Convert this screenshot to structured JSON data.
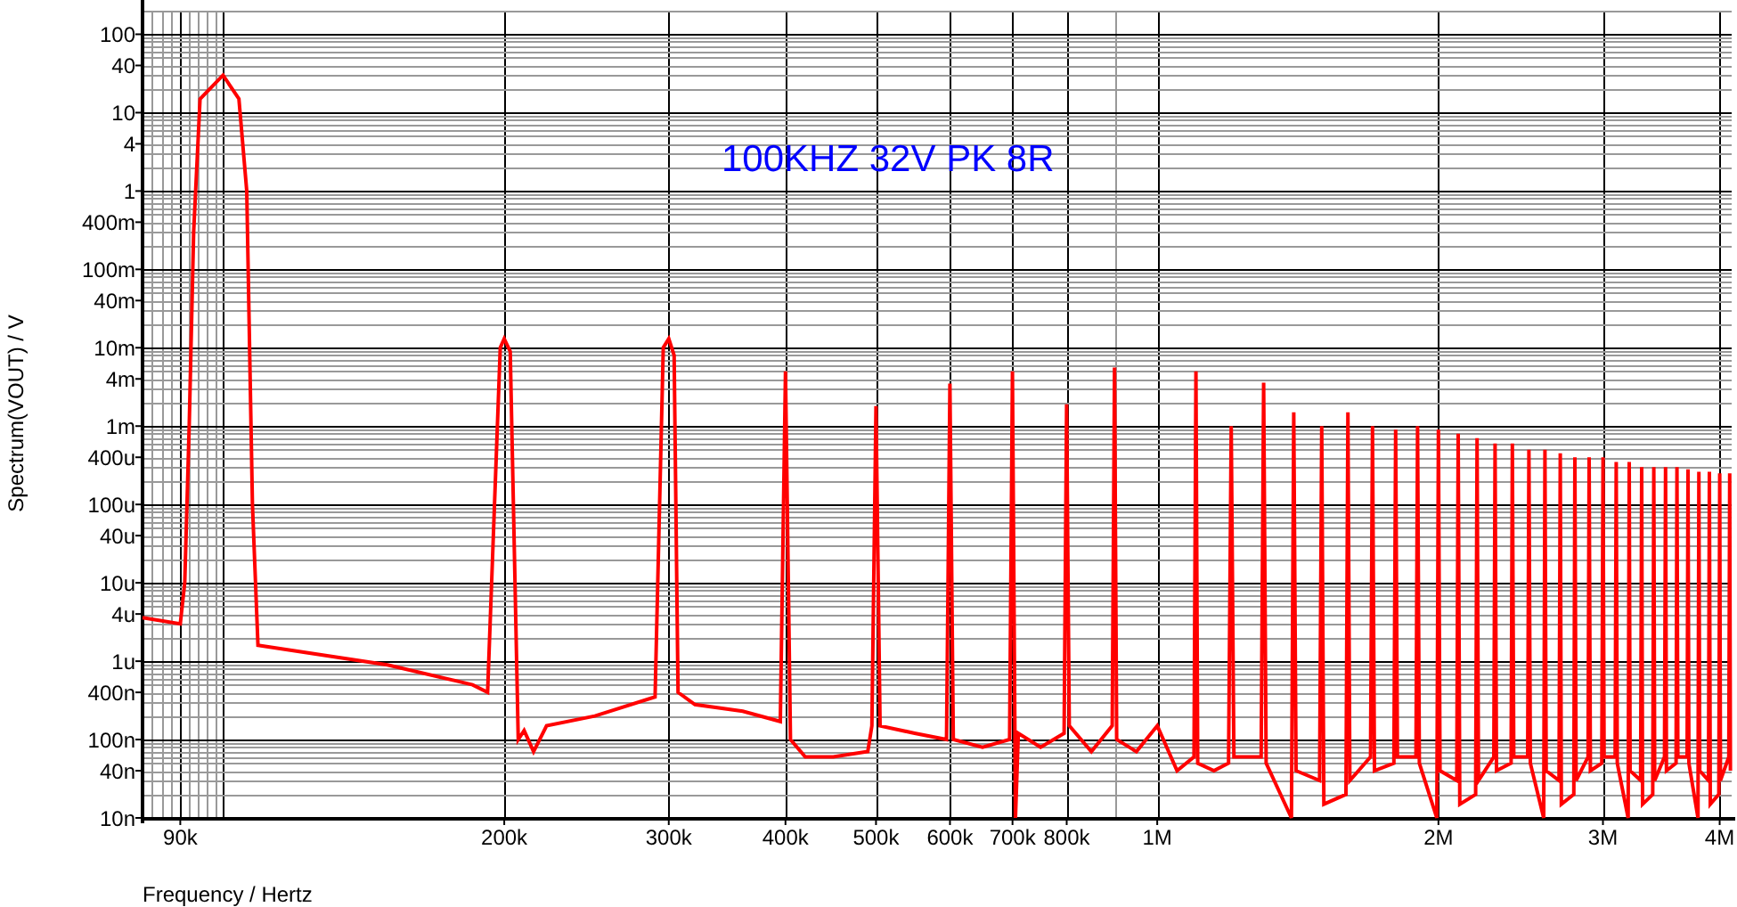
{
  "plot": {
    "title": "100KHZ 32V PK 8R",
    "y_axis_label": "Spectrum(VOUT) / V",
    "x_axis_label": "Frequency / Hertz",
    "y_tick_labels": [
      "100",
      "40",
      "10",
      "4",
      "1",
      "400m",
      "100m",
      "40m",
      "10m",
      "4m",
      "1m",
      "400u",
      "100u",
      "40u",
      "10u",
      "4u",
      "1u",
      "400n",
      "100n",
      "40n",
      "10n"
    ],
    "x_tick_labels": [
      "90k",
      "200k",
      "300k",
      "400k",
      "500k",
      "600k",
      "700k",
      "800k",
      "1M",
      "2M",
      "3M",
      "4M"
    ]
  }
}
